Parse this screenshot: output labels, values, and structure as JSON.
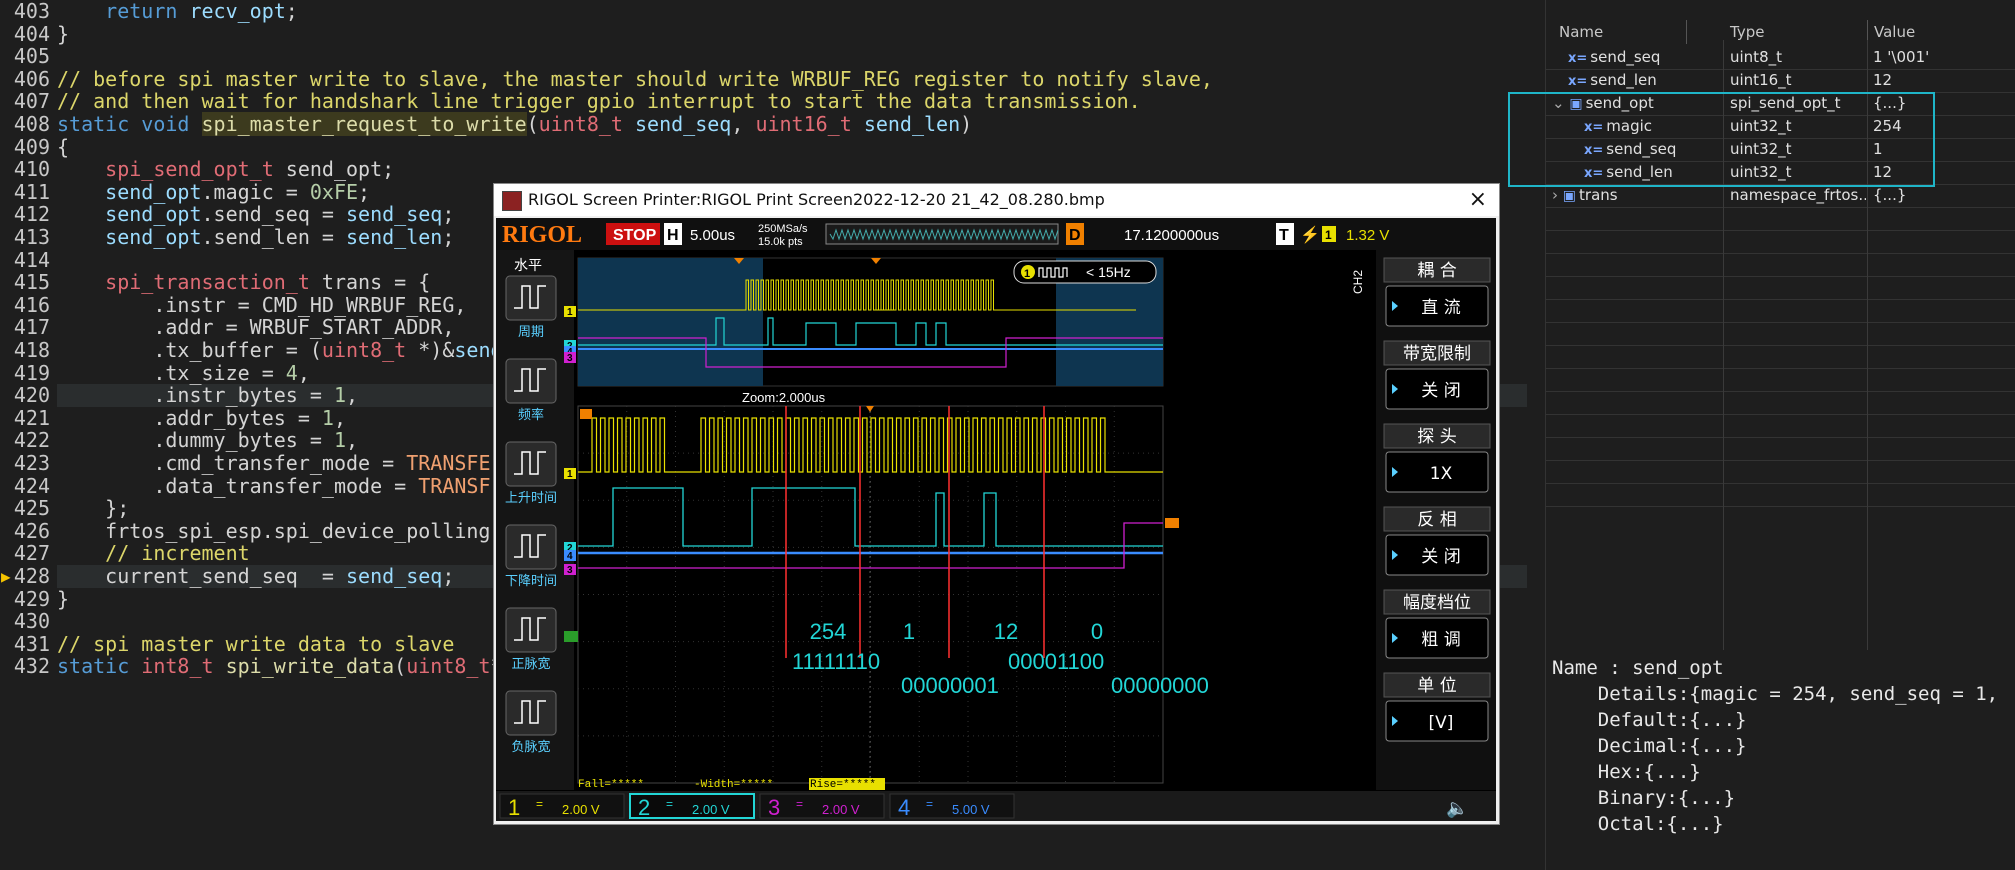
{
  "editor": {
    "lines": [
      {
        "n": "403",
        "html": "    <span class='kwb'>return</span> <span class='var'>recv_opt</span>;"
      },
      {
        "n": "404",
        "html": "}"
      },
      {
        "n": "405",
        "html": ""
      },
      {
        "n": "406",
        "html": "<span class='cm'>// before spi master write to slave, the master should write WRBUF_REG register to notify slave,</span>"
      },
      {
        "n": "407",
        "html": "<span class='cm'>// and then wait for handshark line trigger gpio interrupt to start the data transmission.</span>"
      },
      {
        "n": "408",
        "html": "<span class='kwb'>static</span> <span class='kwb'>void</span> <span class='fn hlfn'>spi_master_request_to_write</span>(<span class='ty'>uint8_t</span> <span class='var'>send_seq</span>, <span class='ty'>uint16_t</span> <span class='var'>send_len</span>)"
      },
      {
        "n": "409",
        "html": "{"
      },
      {
        "n": "410",
        "html": "    <span class='ty'>spi_send_opt_t</span> send_opt;"
      },
      {
        "n": "411",
        "html": "    <span class='var'>send_opt</span>.magic = <span class='num'>0xFE</span>;"
      },
      {
        "n": "412",
        "html": "    <span class='var'>send_opt</span>.send_seq = <span class='var'>send_seq</span>;"
      },
      {
        "n": "413",
        "html": "    <span class='var'>send_opt</span>.send_len = <span class='var'>send_len</span>;"
      },
      {
        "n": "414",
        "html": ""
      },
      {
        "n": "415",
        "html": "    <span class='ty'>spi_transaction_t</span> trans = {"
      },
      {
        "n": "416",
        "html": "        .instr = CMD_HD_WRBUF_REG,"
      },
      {
        "n": "417",
        "html": "        .addr = WRBUF_START_ADDR,"
      },
      {
        "n": "418",
        "html": "        .tx_buffer = (<span class='ty'>uint8_t</span> *)&amp;<span class='var'>send</span>"
      },
      {
        "n": "419",
        "html": "        .tx_size = <span class='num'>4</span>,"
      },
      {
        "n": "420",
        "html": "        .instr_bytes = <span class='num'>1</span>,"
      },
      {
        "n": "421",
        "html": "        .addr_bytes = <span class='num'>1</span>,"
      },
      {
        "n": "422",
        "html": "        .dummy_bytes = <span class='num'>1</span>,"
      },
      {
        "n": "423",
        "html": "        .cmd_transfer_mode = <span class='mac'>TRANSFE</span>"
      },
      {
        "n": "424",
        "html": "        .data_transfer_mode = <span class='mac'>TRANSF</span>"
      },
      {
        "n": "425",
        "html": "    };"
      },
      {
        "n": "426",
        "html": "    frtos_spi_esp.spi_device_polling"
      },
      {
        "n": "427",
        "html": "    <span class='cm'>// increment</span>"
      },
      {
        "n": "428",
        "html": "    current_send_seq  = <span class='var'>send_seq</span>;"
      },
      {
        "n": "429",
        "html": "}"
      },
      {
        "n": "430",
        "html": ""
      },
      {
        "n": "431",
        "html": "<span class='cm'>// spi master write data to slave</span>"
      },
      {
        "n": "432",
        "html": "<span class='kwb'>static</span> <span class='ty'>int8_t</span> <span class='fn'>spi_write_data</span>(<span class='ty'>uint8_t</span>* <span class='var'>buf</span>, <span class='ty'>int32_t</span> <span class='var'>len</span>)"
      }
    ]
  },
  "watch": {
    "headers": [
      "Name",
      "Type",
      "Value"
    ],
    "rows": [
      {
        "indent": 1,
        "icon": "x=",
        "name": "send_seq",
        "type": "uint8_t",
        "value": "1 '\\001'"
      },
      {
        "indent": 1,
        "icon": "x=",
        "name": "send_len",
        "type": "uint16_t",
        "value": "12"
      },
      {
        "indent": 0,
        "icon": "box",
        "expand": "v",
        "name": "send_opt",
        "type": "spi_send_opt_t",
        "value": "{...}"
      },
      {
        "indent": 2,
        "icon": "x=",
        "name": "magic",
        "type": "uint32_t",
        "value": "254"
      },
      {
        "indent": 2,
        "icon": "x=",
        "name": "send_seq",
        "type": "uint32_t",
        "value": "1"
      },
      {
        "indent": 2,
        "icon": "x=",
        "name": "send_len",
        "type": "uint32_t",
        "value": "12"
      },
      {
        "indent": 0,
        "icon": "box",
        "expand": ">",
        "name": "trans",
        "type": "namespace_frtos...",
        "value": "{...}"
      }
    ],
    "detail": [
      "Name : send_opt",
      "    Details:{magic = 254, send_seq = 1,",
      "    Default:{...}",
      "    Decimal:{...}",
      "    Hex:{...}",
      "    Binary:{...}",
      "    Octal:{...}"
    ]
  },
  "scope": {
    "window_title": "RIGOL Screen Printer:RIGOL Print Screen2022-12-20 21_42_08.280.bmp",
    "close": "×",
    "brand": "RIGOL",
    "stop": "STOP",
    "h_label": "H",
    "timebase": "5.00us",
    "sample_rate": "250MSa/s",
    "points": "15.0k pts",
    "d_label": "D",
    "delay": "17.1200000us",
    "t_label": "T",
    "trig_ch": "1",
    "trig_level": "1.32 V",
    "freq": "< 15Hz",
    "freq_ch": "1",
    "zoom": "Zoom:2.000us",
    "left_title": "水平",
    "left_buttons": [
      "周期",
      "频率",
      "上升时间",
      "下降时间",
      "正脉宽",
      "负脉宽"
    ],
    "right_menu": [
      {
        "title": "耦 合",
        "value": "直 流"
      },
      {
        "title": "带宽限制",
        "value": "关 闭"
      },
      {
        "title": "探 头",
        "value": "1X"
      },
      {
        "title": "反 相",
        "value": "关 闭"
      },
      {
        "title": "幅度档位",
        "value": "粗 调"
      },
      {
        "title": "单 位",
        "value": "[V]"
      }
    ],
    "ch2_label": "CH2",
    "decoded_values": [
      "254",
      "1",
      "12",
      "0"
    ],
    "decoded_binary": [
      "11111110",
      "00000001",
      "00001100",
      "00000000"
    ],
    "status_fall": "Fall=*****",
    "status_width": "-Width=*****",
    "status_rise": "Rise=*****",
    "channels": [
      {
        "n": "1",
        "scale": "2.00 V",
        "color": "#e8e000"
      },
      {
        "n": "2",
        "scale": "2.00 V",
        "color": "#22d6d6"
      },
      {
        "n": "3",
        "scale": "2.00 V",
        "color": "#d020d0"
      },
      {
        "n": "4",
        "scale": "5.00 V",
        "color": "#3a8cff"
      }
    ],
    "colors": {
      "ch1": "#e8e000",
      "ch2": "#22d6d6",
      "ch3": "#d020d0",
      "ch4": "#3a8cff",
      "cursor": "#ff3030"
    }
  }
}
